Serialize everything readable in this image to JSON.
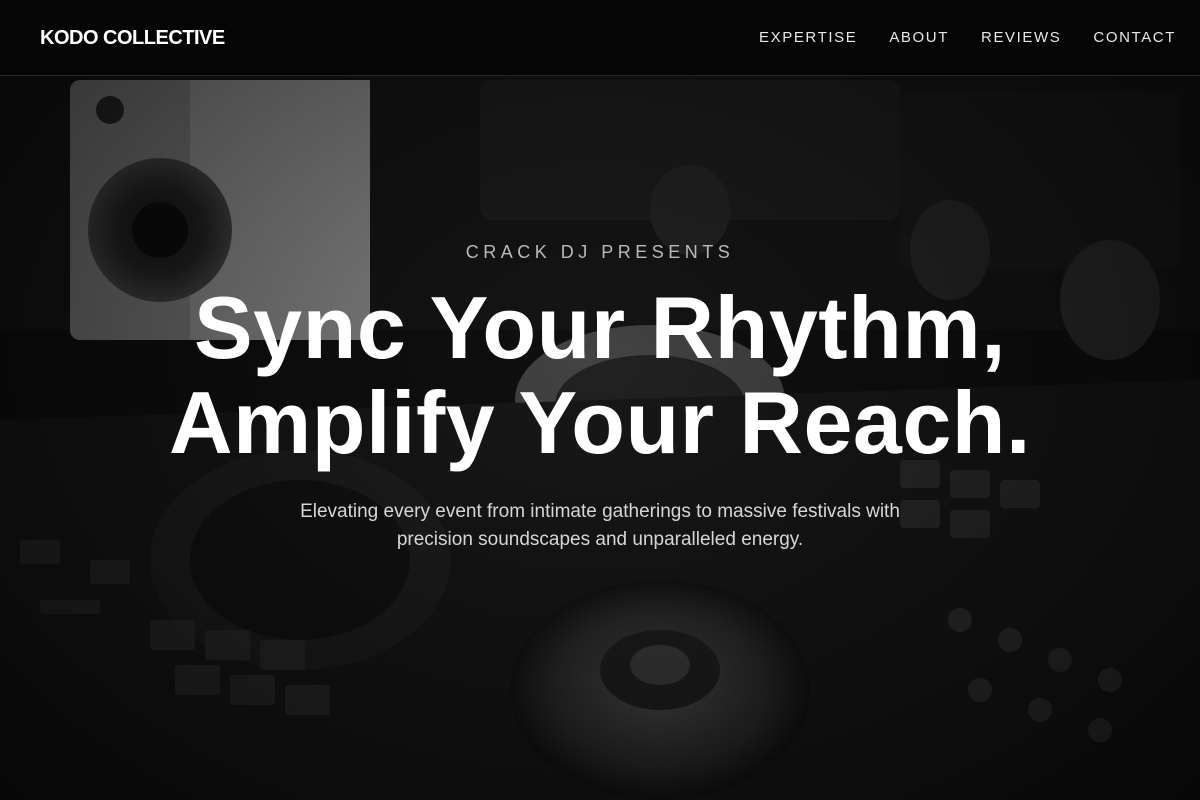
{
  "nav": {
    "brand": "KODO COLLECTIVE",
    "links": [
      {
        "label": "EXPERTISE"
      },
      {
        "label": "ABOUT"
      },
      {
        "label": "REVIEWS"
      },
      {
        "label": "CONTACT"
      }
    ]
  },
  "hero": {
    "eyebrow": "CRACK DJ PRESENTS",
    "headline": "Sync Your Rhythm, Amplify Your Reach.",
    "subtitle": "Elevating every event from intimate gatherings to massive festivals with precision soundscapes and unparalleled energy.",
    "background_image": "grayscale-dj-controller-headphones-speaker"
  },
  "colors": {
    "nav_background": "#050505",
    "text_primary": "#ffffff",
    "text_muted": "#b9b9b9"
  }
}
